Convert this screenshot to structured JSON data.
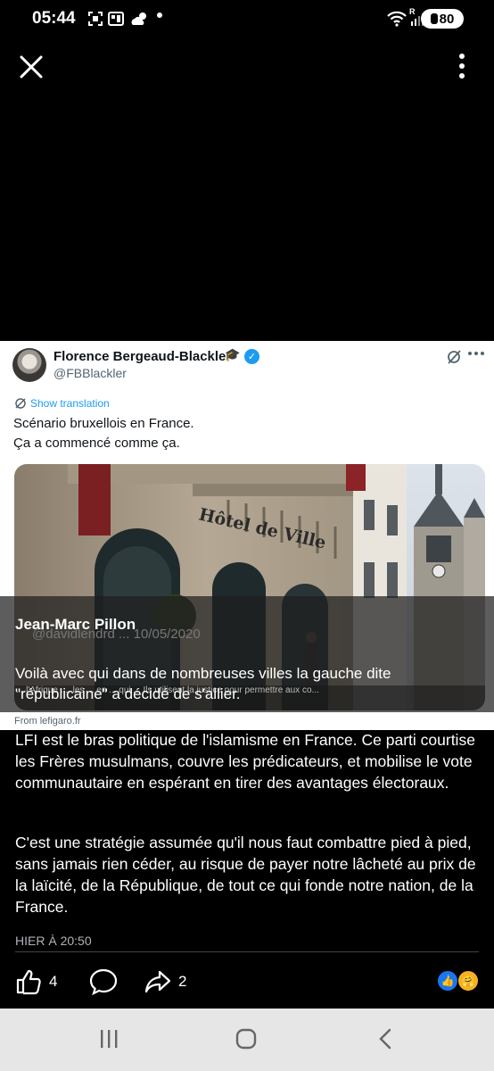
{
  "status_bar": {
    "time": "05:44",
    "battery": "80",
    "roaming_indicator": "R",
    "icons": [
      "screenshot-icon",
      "gallery-icon",
      "weather-icon",
      "dot-icon",
      "wifi-icon",
      "signal-icon",
      "battery-icon"
    ]
  },
  "top_bar": {
    "icons": [
      "close-icon",
      "more-vertical-icon"
    ]
  },
  "tweet": {
    "author_name": "Florence Bergeaud-Blackler",
    "handle": "@FBBlackler",
    "show_translation": "Show translation",
    "text_line1": "Scénario bruxellois en France.",
    "text_line2": "Ça a commencé comme ça.",
    "image_sign": "Hôtel de Ville",
    "link_source": "From lefigaro.fr",
    "link_caption": "... l'Afrique ..., les ... en ... qui ... Ils utilisent la justice pour permettre aux co...",
    "accent_color": "#1d9bf0"
  },
  "post": {
    "author": "Jean-Marc Pillon",
    "ghost_handle": "@davidlendrd ... 10/05/2020",
    "quote_line1": "Voilà avec qui dans de nombreuses villes la gauche dite",
    "quote_line2": "\"républicaine\" a décidé de s'allier.",
    "paragraph1": "LFI est le bras politique de l'islamisme en France. Ce parti courtise les Frères musulmans, couvre les prédicateurs, et mobilise le vote communautaire en espérant en tirer des avantages électoraux.",
    "paragraph2": "C'est une stratégie assumée qu'il nous faut combattre pied à pied, sans jamais rien céder, au risque de payer notre lâcheté au prix de la laïcité, de la République, de tout ce qui fonde notre nation, de la France.",
    "timestamp": "HIER À 20:50",
    "like_count": "4",
    "share_count": "2",
    "reaction_colors": {
      "like": "#1877f2",
      "care": "#f7b125"
    }
  },
  "nav_bar": {
    "icons": [
      "recent-apps-icon",
      "home-icon",
      "back-icon"
    ]
  }
}
